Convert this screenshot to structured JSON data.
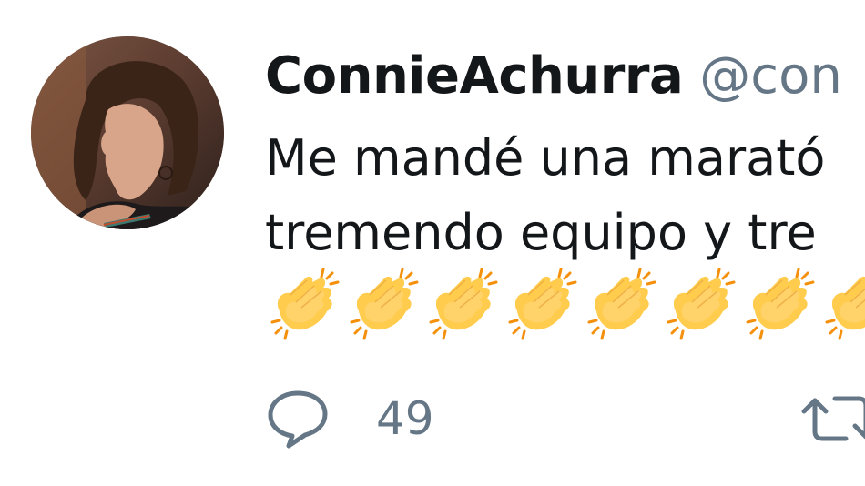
{
  "tweet": {
    "display_name": "ConnieAchurra",
    "handle": "@con",
    "text_line1": "Me mandé una marató",
    "text_line2": "tremendo equipo y tre",
    "emoji": [
      "clapping-hands",
      "clapping-hands",
      "clapping-hands",
      "clapping-hands",
      "clapping-hands",
      "clapping-hands",
      "clapping-hands",
      "clapping-hands"
    ],
    "reply_count": "49"
  },
  "colors": {
    "name": "#14171a",
    "secondary": "#657786",
    "clap_yellow": "#ffcc4d",
    "clap_orange": "#f4900c"
  },
  "icons": {
    "reply": "speech-bubble-icon",
    "retweet": "retweet-arrows-icon"
  }
}
